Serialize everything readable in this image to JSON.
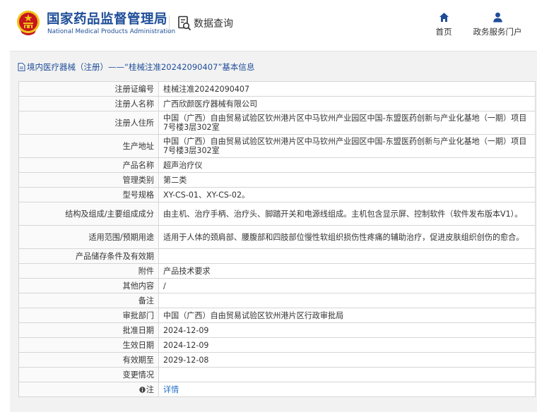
{
  "header": {
    "brand_title": "国家药品监督管理局",
    "brand_subtitle": "National Medical Products Administration",
    "query_label": "数据查询",
    "nav": [
      {
        "label": "首页",
        "icon": "home-icon"
      },
      {
        "label": "政务服务门户",
        "icon": "user-icon"
      }
    ]
  },
  "breadcrumb": {
    "text": "境内医疗器械（注册）——“桂械注准20242090407”基本信息",
    "icon": "document-icon"
  },
  "record": {
    "rows": [
      {
        "label": "注册证编号",
        "value": "桂械注准20242090407"
      },
      {
        "label": "注册人名称",
        "value": "广西欣颜医疗器械有限公司"
      },
      {
        "label": "注册人住所",
        "value": "中国（广西）自由贸易试验区钦州港片区中马钦州产业园区中国-东盟医药创新与产业化基地（一期）项目7号楼3层302室"
      },
      {
        "label": "生产地址",
        "value": "中国（广西）自由贸易试验区钦州港片区中马钦州产业园区中国-东盟医药创新与产业化基地（一期）项目7号楼3层302室"
      },
      {
        "label": "产品名称",
        "value": "超声治疗仪"
      },
      {
        "label": "管理类别",
        "value": "第二类"
      },
      {
        "label": "型号规格",
        "value": "XY-CS-01、XY-CS-02。"
      },
      {
        "label": "结构及组成/主要组成成分",
        "value": "由主机、治疗手柄、治疗头、脚踏开关和电源线组成。主机包含显示屏、控制软件（软件发布版本V1）。"
      },
      {
        "label": "适用范围/预期用途",
        "value": "适用于人体的颈肩部、腰腹部和四肢部位慢性软组织损伤性疼痛的辅助治疗，促进皮肤组织创伤的愈合。"
      },
      {
        "label": "产品储存条件及有效期",
        "value": ""
      },
      {
        "label": "附件",
        "value": "产品技术要求"
      },
      {
        "label": "其他内容",
        "value": "/"
      },
      {
        "label": "备注",
        "value": ""
      },
      {
        "label": "审批部门",
        "value": "中国（广西）自由贸易试验区钦州港片区行政审批局"
      },
      {
        "label": "批准日期",
        "value": "2024-12-09"
      },
      {
        "label": "生效日期",
        "value": "2024-12-09"
      },
      {
        "label": "有效期至",
        "value": "2029-12-08"
      },
      {
        "label": "变更情况",
        "value": ""
      }
    ],
    "note_row": {
      "label": "注",
      "icon": "info-icon",
      "link_text": "详情"
    }
  },
  "colors": {
    "brand_blue": "#1f4e99",
    "link_blue": "#1f6fc5",
    "emblem_red": "#c8161d",
    "emblem_gold": "#f0c419",
    "panel_bg": "#f2f2f2",
    "border": "#d6d6d6"
  }
}
